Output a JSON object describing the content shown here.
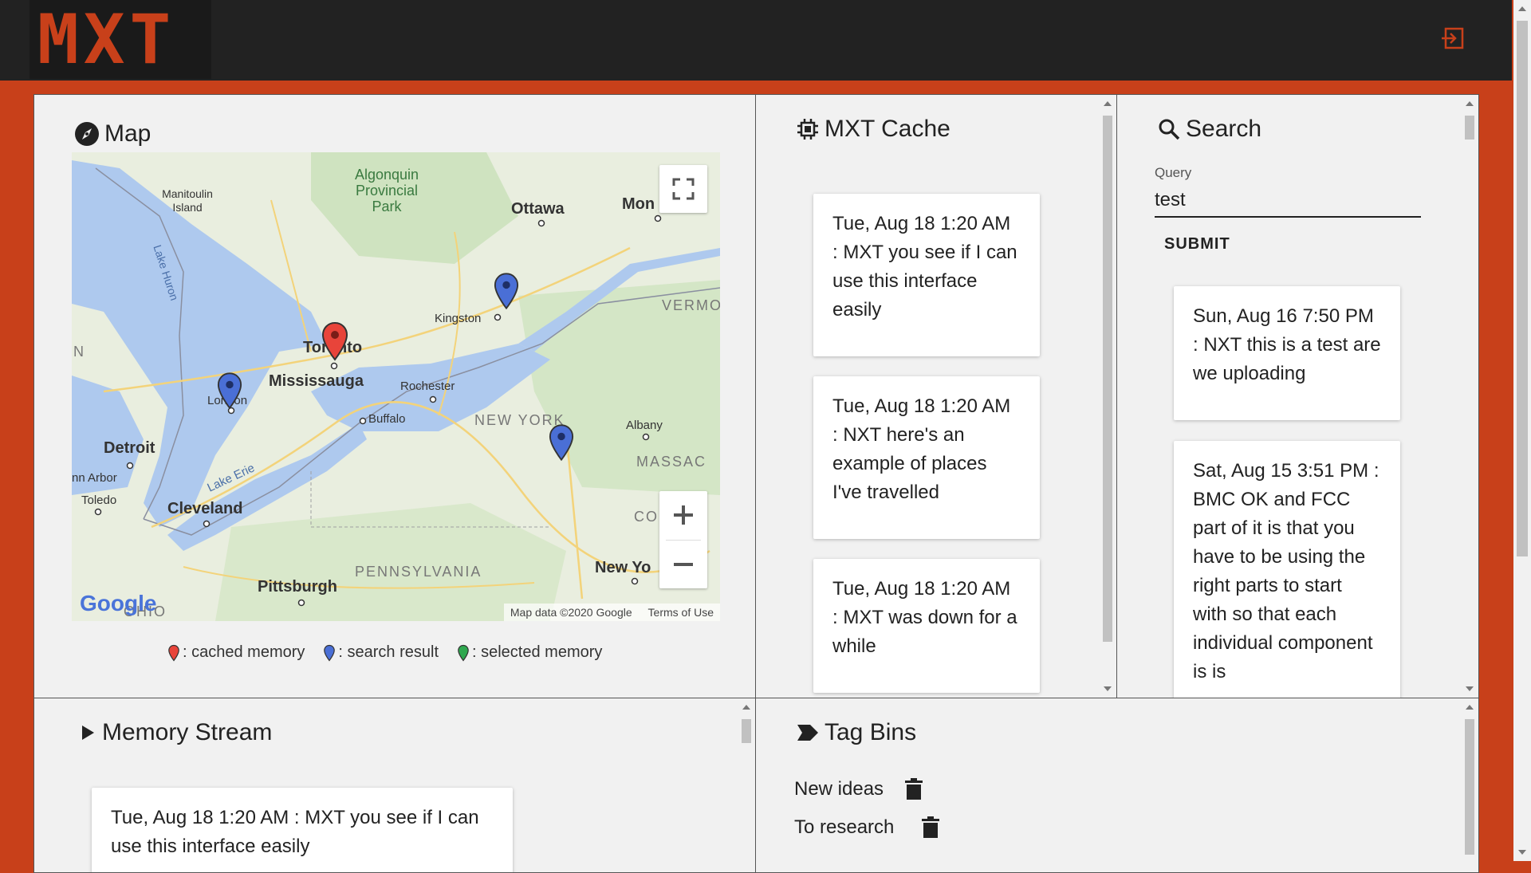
{
  "header": {
    "logo_text": "MXT",
    "logout_icon": "logout-icon"
  },
  "map_panel": {
    "title": "Map",
    "icon": "compass-icon",
    "place_labels": {
      "algonquin": "Algonquin Provincial Park",
      "manitoulin": "Manitoulin Island",
      "ottawa": "Ottawa",
      "montreal": "Mon",
      "kingston": "Kingston",
      "toronto": "Toronto",
      "mississauga": "Mississauga",
      "rochester": "Rochester",
      "london": "London",
      "buffalo": "Buffalo",
      "detroit": "Detroit",
      "ann_arbor": "nn Arbor",
      "toledo": "Toledo",
      "cleveland": "Cleveland",
      "new_york_state": "NEW YORK",
      "albany": "Albany",
      "vermont": "VERMO",
      "massachusetts": "MASSAC",
      "connecticut": "CO",
      "pennsylvania": "PENNSYLVANIA",
      "pittsburgh": "Pittsburgh",
      "new_york_city": "New Yo",
      "lake_huron": "Lake Huron",
      "lake_erie": "Lake Erie",
      "ohio": "OHIO",
      "n_edge": "N"
    },
    "attribution": "Map data ©2020 Google",
    "terms": "Terms of Use",
    "google": "Google",
    "legend": {
      "cached": ": cached memory",
      "search": ": search result",
      "selected": ": selected memory"
    },
    "colors": {
      "cached": "#e8443a",
      "search": "#4a6fd6",
      "selected": "#2fa84f"
    }
  },
  "cache_panel": {
    "title": "MXT Cache",
    "icon": "chip-icon",
    "cards": [
      "Tue, Aug 18 1:20 AM : MXT you see if I can use this interface easily",
      "Tue, Aug 18 1:20 AM : NXT here's an example of places I've travelled",
      "Tue, Aug 18 1:20 AM : MXT was down for a while"
    ]
  },
  "search_panel": {
    "title": "Search",
    "icon": "search-icon",
    "query_label": "Query",
    "query_value": "test",
    "submit_label": "SUBMIT",
    "results": [
      "Sun, Aug 16 7:50 PM : NXT this is a test are we uploading",
      "Sat, Aug 15 3:51 PM : BMC OK and FCC part of it is that you have to be using the right parts to start with so that each individual component is is"
    ]
  },
  "stream_panel": {
    "title": "Memory Stream",
    "icon": "play-icon",
    "cards": [
      "Tue, Aug 18 1:20 AM : MXT you see if I can use this interface easily"
    ]
  },
  "tags_panel": {
    "title": "Tag Bins",
    "icon": "tag-icon",
    "tags": [
      "New ideas",
      "To research"
    ]
  }
}
